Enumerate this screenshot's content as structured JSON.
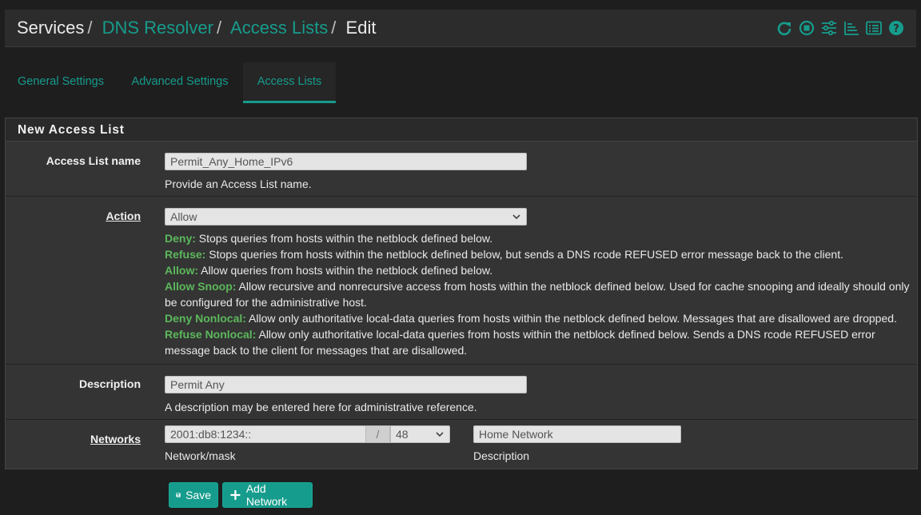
{
  "breadcrumb": {
    "items": [
      "Services",
      "DNS Resolver",
      "Access Lists",
      "Edit"
    ],
    "separator": "/"
  },
  "header_icons": [
    "reload-icon",
    "stop-icon",
    "settings-sliders-icon",
    "chart-icon",
    "list-icon",
    "help-icon"
  ],
  "tabs": [
    {
      "label": "General Settings"
    },
    {
      "label": "Advanced Settings"
    },
    {
      "label": "Access Lists"
    }
  ],
  "panel": {
    "title": "New Access List",
    "name": {
      "label": "Access List name",
      "value": "Permit_Any_Home_IPv6",
      "help": "Provide an Access List name."
    },
    "action": {
      "label": "Action",
      "selected": "Allow",
      "help": [
        {
          "term": "Deny:",
          "text": " Stops queries from hosts within the netblock defined below."
        },
        {
          "term": "Refuse:",
          "text": " Stops queries from hosts within the netblock defined below, but sends a DNS rcode REFUSED error message back to the client."
        },
        {
          "term": "Allow:",
          "text": " Allow queries from hosts within the netblock defined below."
        },
        {
          "term": "Allow Snoop:",
          "text": " Allow recursive and nonrecursive access from hosts within the netblock defined below. Used for cache snooping and ideally should only be configured for the administrative host."
        },
        {
          "term": "Deny Nonlocal:",
          "text": " Allow only authoritative local-data queries from hosts within the netblock defined below. Messages that are disallowed are dropped."
        },
        {
          "term": "Refuse Nonlocal:",
          "text": " Allow only authoritative local-data queries from hosts within the netblock defined below. Sends a DNS rcode REFUSED error message back to the client for messages that are disallowed."
        }
      ]
    },
    "description": {
      "label": "Description",
      "value": "Permit Any",
      "help": "A description may be entered here for administrative reference."
    },
    "networks": {
      "label": "Networks",
      "network_value": "2001:db8:1234::",
      "slash": "/",
      "mask_value": "48",
      "network_help": "Network/mask",
      "desc_value": "Home Network",
      "desc_help": "Description"
    }
  },
  "buttons": {
    "save": "Save",
    "add_network": "Add Network"
  },
  "colors": {
    "accent": "#169c8c",
    "help_term": "#5cb85c",
    "background": "#1e1e1e",
    "panel": "#343434"
  }
}
